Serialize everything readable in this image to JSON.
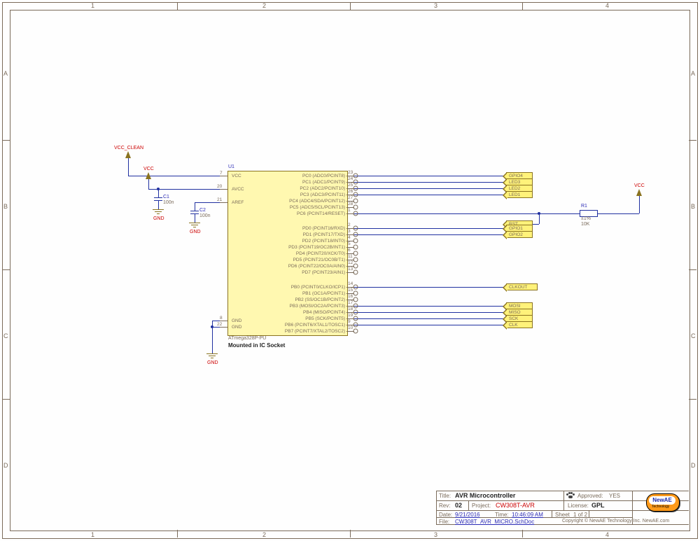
{
  "sheet": {
    "border_letters": [
      "A",
      "B",
      "C",
      "D"
    ],
    "border_numbers": [
      "1",
      "2",
      "3",
      "4"
    ]
  },
  "power": {
    "vcc_clean": "VCC_CLEAN",
    "vcc": "VCC",
    "gnd": "GND"
  },
  "caps": {
    "c1_ref": "C1",
    "c1_val": "100n",
    "c2_ref": "C2",
    "c2_val": "100n"
  },
  "resistor": {
    "ref": "R1",
    "tol": "±1%",
    "val": "10K"
  },
  "ic": {
    "ref": "U1",
    "part": "ATmega328P-PU",
    "note": "Mounted in IC Socket",
    "left_pins": [
      {
        "num": "7",
        "name": "VCC"
      },
      {
        "num": "20",
        "name": "AVCC"
      },
      {
        "num": "21",
        "name": "AREF"
      },
      {
        "num": "8",
        "name": "GND"
      },
      {
        "num": "22",
        "name": "GND"
      }
    ],
    "right_pins": [
      {
        "num": "23",
        "name": "PC0 (ADC0/PCINT8)"
      },
      {
        "num": "24",
        "name": "PC1 (ADC1/PCINT9)"
      },
      {
        "num": "25",
        "name": "PC2 (ADC2/PCINT10)"
      },
      {
        "num": "26",
        "name": "PC3 (ADC3/PCINT11)"
      },
      {
        "num": "27",
        "name": "PC4 (ADC4/SDA/PCINT12)"
      },
      {
        "num": "28",
        "name": "PC5 (ADC5/SCL/PCINT13)"
      },
      {
        "num": "1",
        "name": "PC6 (PCINT14/RESET)"
      },
      {
        "num": "2",
        "name": "PD0 (PCINT16/RXD)"
      },
      {
        "num": "3",
        "name": "PD1 (PCINT17/TXD)"
      },
      {
        "num": "4",
        "name": "PD2 (PCINT18/INT0)"
      },
      {
        "num": "5",
        "name": "PD3 (PCINT19/OC2B/INT1)"
      },
      {
        "num": "6",
        "name": "PD4 (PCINT20/XCK/T0)"
      },
      {
        "num": "11",
        "name": "PD5 (PCINT21/OC0B/T1)"
      },
      {
        "num": "12",
        "name": "PD6 (PCINT22/OC0A/AIN0)"
      },
      {
        "num": "13",
        "name": "PD7 (PCINT23/AIN1)"
      },
      {
        "num": "14",
        "name": "PB0 (PCINT0/CLKO/ICP1)"
      },
      {
        "num": "15",
        "name": "PB1 (OC1A/PCINT1)"
      },
      {
        "num": "16",
        "name": "PB2 (SS/OC1B/PCINT2)"
      },
      {
        "num": "17",
        "name": "PB3 (MOSI/OC2A/PCINT3)"
      },
      {
        "num": "18",
        "name": "PB4 (MISO/PCINT4)"
      },
      {
        "num": "19",
        "name": "PB5 (SCK/PCINT5)"
      },
      {
        "num": "9",
        "name": "PB6 (PCINT6/XTAL1/TOSC1)"
      },
      {
        "num": "10",
        "name": "PB7 (PCINT7/XTAL2/TOSC2)"
      }
    ]
  },
  "nets": {
    "gpio4": "GPIO4",
    "led3": "LED3",
    "led2": "LED2",
    "led1": "LED1",
    "rst": "RST",
    "gpio1": "GPIO1",
    "gpio2": "GPIO2",
    "clkout": "CLKOUT",
    "mosi": "MOSI",
    "miso": "MISO",
    "sck": "SCK",
    "clk": "CLK"
  },
  "title_block": {
    "title_label": "Title:",
    "title": "AVR Microcontroller",
    "rev_label": "Rev:",
    "rev": "02",
    "project_label": "Project:",
    "project": "CW308T-AVR",
    "approved_label": "Approved:",
    "approved": "YES",
    "license_label": "License:",
    "license": "GPL",
    "date_label": "Date:",
    "date": "9/21/2016",
    "time_label": "Time:",
    "time": "10:46:09 AM",
    "sheet_label": "Sheet",
    "sheet_of": "1     of    2",
    "file_label": "File:",
    "file": "CW308T_AVR_MICRO.SchDoc",
    "copyright": "Copyright © NewAE Technology Inc.      NewAE.com",
    "logo_text": "NewAE",
    "logo_sub": "Technology"
  }
}
